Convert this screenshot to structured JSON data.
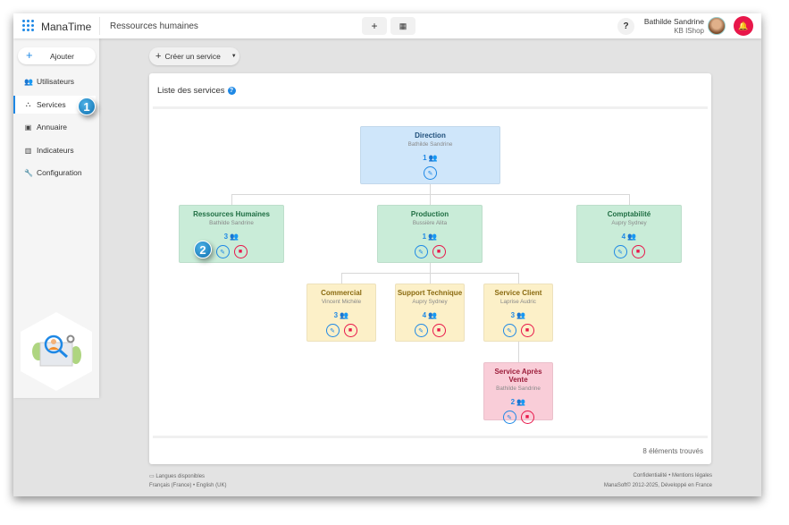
{
  "header": {
    "brand": "ManaTime",
    "page_title": "Ressources humaines",
    "add_icon": "+",
    "calendar_icon": "▦",
    "help": "?",
    "user_name": "Bathilde Sandrine",
    "user_company": "KB IShop"
  },
  "sidebar": {
    "add_label": "Ajouter",
    "items": [
      {
        "label": "Utilisateurs",
        "icon": "users-icon"
      },
      {
        "label": "Services",
        "icon": "sitemap-icon"
      },
      {
        "label": "Annuaire",
        "icon": "address-book-icon"
      },
      {
        "label": "Indicateurs",
        "icon": "chart-icon"
      },
      {
        "label": "Configuration",
        "icon": "wrench-icon"
      }
    ]
  },
  "badges": [
    "1",
    "2"
  ],
  "toolbar": {
    "create_label": "Créer un service"
  },
  "card": {
    "title": "Liste des services",
    "count_text": "8 éléments trouvés"
  },
  "colors": {
    "accent": "#1e88e5",
    "danger": "#e8174a",
    "blue_node": "#cfe6fa",
    "green_node": "#c9ecd8",
    "yellow_node": "#fcf0c8",
    "pink_node": "#f9cdd8"
  },
  "services": [
    {
      "id": "direction",
      "name": "Direction",
      "manager": "Bathilde Sandrine",
      "count": "1",
      "level": "blue",
      "deletable": false
    },
    {
      "id": "rh",
      "name": "Ressources Humaines",
      "manager": "Bathilde Sandrine",
      "count": "3",
      "level": "green",
      "deletable": true
    },
    {
      "id": "production",
      "name": "Production",
      "manager": "Bussière Alita",
      "count": "1",
      "level": "green",
      "deletable": true
    },
    {
      "id": "compta",
      "name": "Comptabilité",
      "manager": "Aupry Sydney",
      "count": "4",
      "level": "green",
      "deletable": true
    },
    {
      "id": "commercial",
      "name": "Commercial",
      "manager": "Vincent Michèle",
      "count": "3",
      "level": "yellow",
      "deletable": true
    },
    {
      "id": "support",
      "name": "Support Technique",
      "manager": "Aupry Sydney",
      "count": "4",
      "level": "yellow",
      "deletable": true
    },
    {
      "id": "client",
      "name": "Service Client",
      "manager": "Laprise Audric",
      "count": "3",
      "level": "yellow",
      "deletable": true
    },
    {
      "id": "sav",
      "name": "Service Après Vente",
      "manager": "Bathilde Sandrine",
      "count": "2",
      "level": "pink",
      "deletable": true
    }
  ],
  "footer": {
    "languages_label": "Langues disponibles",
    "lang_fr": "Français (France)",
    "lang_en": "English (UK)",
    "privacy": "Confidentialité",
    "legal": "Mentions légales",
    "copyright": "ManaSoft© 2012-2025, Développé en France",
    "sep": "•"
  }
}
